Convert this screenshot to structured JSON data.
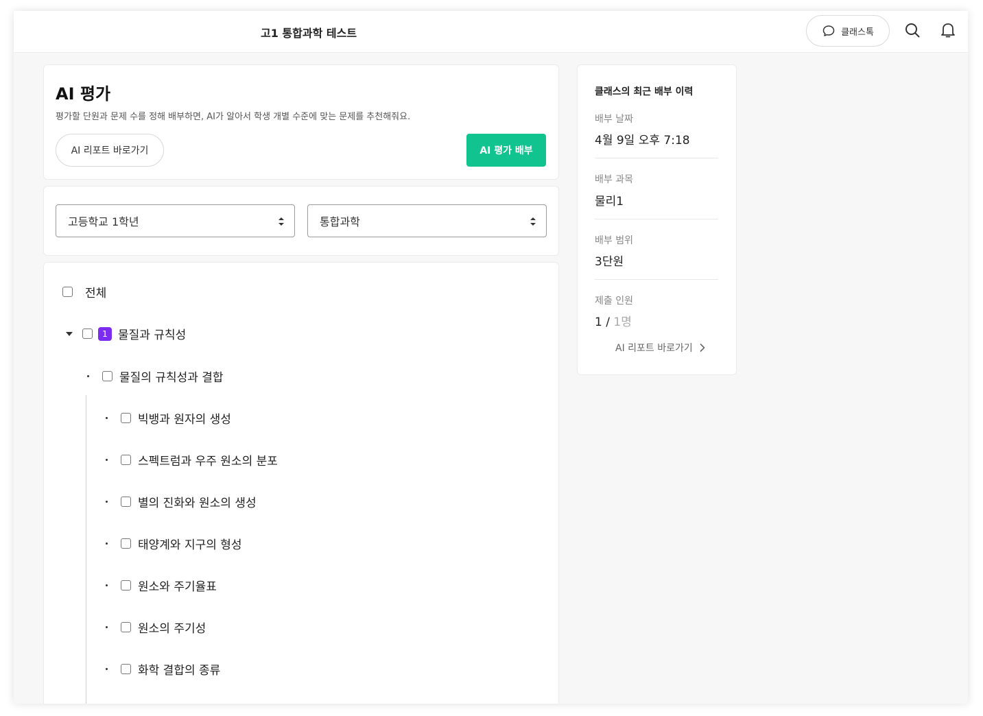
{
  "header": {
    "title": "고1 통합과학 테스트",
    "chat_label": "클래스톡"
  },
  "ai_panel": {
    "title": "AI 평가",
    "description": "평가할 단원과 문제 수를 정해 배부하면, AI가 알아서 학생 개별 수준에 맞는 문제를 추천해줘요.",
    "report_button": "AI 리포트 바로가기",
    "assign_button": "AI 평가 배부",
    "accent_color": "#11c48f"
  },
  "filters": {
    "grade": "고등학교 1학년",
    "subject": "통합과학"
  },
  "tree": {
    "all_label": "전체",
    "unit": {
      "number": "1",
      "label": "물질과 규칙성"
    },
    "subunit": "물질의 규칙성과 결합",
    "topics": [
      "빅뱅과 원자의 생성",
      "스펙트럼과 우주 원소의 분포",
      "별의 진화와 원소의 생성",
      "태양계와 지구의 형성",
      "원소와 주기율표",
      "원소의 주기성",
      "화학 결합의 종류"
    ]
  },
  "history": {
    "heading": "클래스의 최근 배부 이력",
    "date_label": "배부 날짜",
    "date_value": "4월 9일 오후 7:18",
    "subject_label": "배부 과목",
    "subject_value": "물리1",
    "range_label": "배부 범위",
    "range_value": "3단원",
    "submit_label": "제출 인원",
    "submit_count": "1",
    "submit_sep": " / ",
    "submit_total": "1명",
    "report_link": "AI 리포트 바로가기"
  }
}
